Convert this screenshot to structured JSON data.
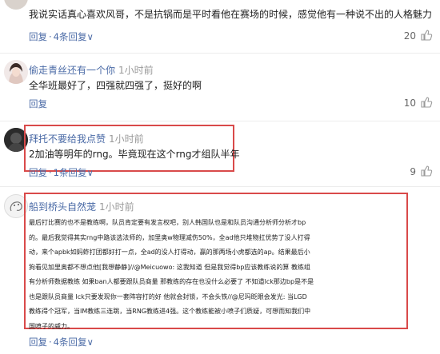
{
  "comments": [
    {
      "username": "",
      "time": "",
      "text": "我说实话真心喜欢风哥，不是抗锅而是平时看他在赛场的时候，感觉他有一种说不出的人格魅力",
      "reply": "回复",
      "replies": "4条回复",
      "likes": "20"
    },
    {
      "username": "偷走青丝还有一个你",
      "time": "1小时前",
      "text": "全华班最好了，四强就四强了，挺好的啊",
      "reply": "回复",
      "likes": "10"
    },
    {
      "username": "拜托不要给我点赞",
      "time": "1小时前",
      "text": "2加油等明年的rng。毕竟现在这个rng才组队半年",
      "reply": "回复",
      "replies": "1条回复",
      "likes": "9"
    },
    {
      "username": "船到桥头自然茏",
      "time": "1小时前",
      "lines": [
        "最后打比赛的也不是教练啊，队员肯定要有发言权吧，别人韩国队也是和队员沟通分析师分析才bp",
        "的。最后我觉得其实rng中路该选法师的，加里奥w物理减伤50%，全ad他只堆物扛优势了没人打得",
        "动，来个apbk如蚂蚱打团都好打一点，全ad的没人打得动，赢的那两场小虎都选的ap。结果最后小",
        "狗看见加里奥都不想点他[我想静静]//@Meicuowo: 这我知道 但是我觉得bp应该教练说的算 教练组",
        "有分析师数据教练 如果ban人都要跟队员商量 那教练的存在也没什么必要了 不知道lck那边bp是不是",
        "也是跟队员商量 lck只要发现你一套阵容打的好 他就会封锁，不会头铁//@尼玛眨眼会发光: 当LGD",
        "教练得个冠军，当IM教练三连跳，当RNG教练进4强。这个教练能被小喷子们质疑，可想而知我们中",
        "国喷子的威力。"
      ],
      "reply": "回复",
      "replies": "4条回复"
    }
  ],
  "accent_color": "#4a6aa6",
  "highlight_color": "#d94a4a",
  "icons": [
    "avatar-cat",
    "avatar-girl",
    "avatar-dark",
    "avatar-doodle",
    "thumb-up-icon"
  ]
}
